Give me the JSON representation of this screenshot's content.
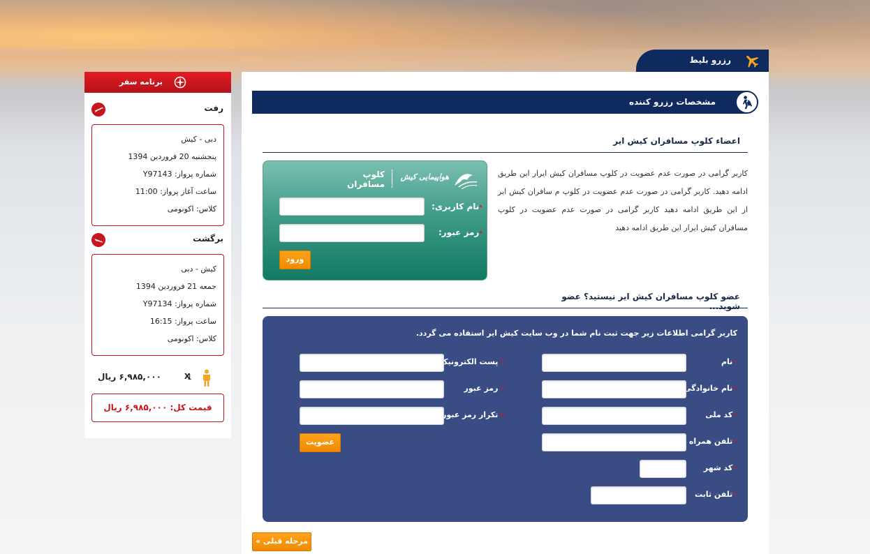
{
  "header": {
    "tab_label": "رزرو بلیط",
    "tab_icon": "airplane-icon"
  },
  "section": {
    "title": "مشخصات رزرو کننده",
    "icon": "traveler-icon"
  },
  "members": {
    "heading": "اعضاء کلوپ مسافران کیش ایر",
    "description": "کاربر گرامی در صورت عدم عضویت در کلوپ مسافران کیش ایرار این طریق ادامه دهید. کاربر گرامی در صورت عدم عضویت در کلوپ م سافران کیش ایر از این طریق ادامه دهید کاربر گرامی در صورت عدم عضویت در کلوپ مسافران کیش ایرار این طریق ادامه دهید",
    "club_logo_text": "هواپیمایی کیش",
    "club_title": "کلوپ مسافران",
    "username_label": "نام کاربری:",
    "password_label": "رمز عبور:",
    "username_value": "",
    "password_value": "",
    "login_button": "ورود"
  },
  "register": {
    "heading": "عضو کلوپ مسافران کیش ایر نیستید؟ عضو شوید...",
    "intro": "کاربر گرامی اطلاعات زیر جهت ثبت نام شما در وب سایت کیش ایر استفاده می گردد.",
    "right_fields": [
      {
        "label": "نام",
        "value": ""
      },
      {
        "label": "نام خانوادگی",
        "value": ""
      },
      {
        "label": "کد ملی",
        "value": ""
      },
      {
        "label": "تلفن همراه",
        "value": ""
      },
      {
        "label": "کد شهر",
        "value": ""
      },
      {
        "label": "تلفن ثابت",
        "value": ""
      }
    ],
    "left_fields": [
      {
        "label": "پست الکترونیک",
        "value": ""
      },
      {
        "label": "رمز عبور",
        "value": ""
      },
      {
        "label": "تکرار رمز عبور",
        "value": ""
      }
    ],
    "submit_button": "عضویت",
    "required_mark": "*"
  },
  "footer": {
    "prev_button": "« مرحله قبلی"
  },
  "sidebar": {
    "title": "برنامه سفر",
    "title_icon": "compass-icon",
    "outbound": {
      "title": "رفت",
      "icon": "plane-takeoff-icon",
      "route": "دبی - کیش",
      "date": "پنجشنبه 20 فروردین 1394",
      "flight": "شماره پرواز: Y97143",
      "time": "ساعت آغاز پرواز: 11:00",
      "class": "کلاس: اکونومی"
    },
    "return": {
      "title": "برگشت",
      "icon": "plane-landing-icon",
      "route": "کیش - دبی",
      "date": "جمعه 21 فروردین 1394",
      "flight": "شماره پرواز: Y97134",
      "time": "ساعت پرواز: 16:15",
      "class": "کلاس: اکونومی"
    },
    "passenger_icon": "person-icon",
    "passenger_count": "1",
    "multiply": "X",
    "price": "۶,۹۸۵,۰۰۰ ریال",
    "total": "قیمت کل: ۶,۹۸۵,۰۰۰ ریال"
  },
  "colors": {
    "navy": "#0f2a5f",
    "red": "#c8151d",
    "orange": "#f39200",
    "teal": "#127a63",
    "form_blue": "#394c84"
  }
}
